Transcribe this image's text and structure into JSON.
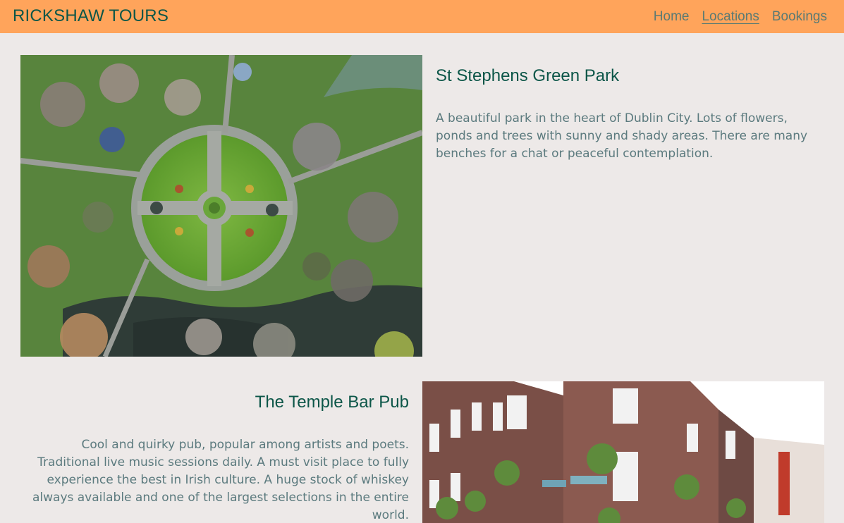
{
  "navbar": {
    "brand": "RICKSHAW TOURS",
    "links": [
      "Home",
      "Locations",
      "Bookings"
    ],
    "active": "Locations",
    "background": "#ffa45b",
    "text_color": "#0c5648"
  },
  "locations": [
    {
      "title": "St Stephens Green Park",
      "description": "A beautiful park in the heart of Dublin City. Lots of flowers, ponds and trees with sunny and shady areas. There are many benches for a chat or peaceful contemplation."
    },
    {
      "title": "The Temple Bar Pub",
      "description": "Cool and quirky pub, popular among artists and poets. Traditional live music sessions daily. A must visit place to fully experience the best in Irish culture. A huge stock of whiskey always available and one of the largest selections in the entire world."
    }
  ],
  "colors": {
    "page_background": "#ede9e8",
    "heading": "#0c5648",
    "body_text": "#5b7a7e"
  }
}
